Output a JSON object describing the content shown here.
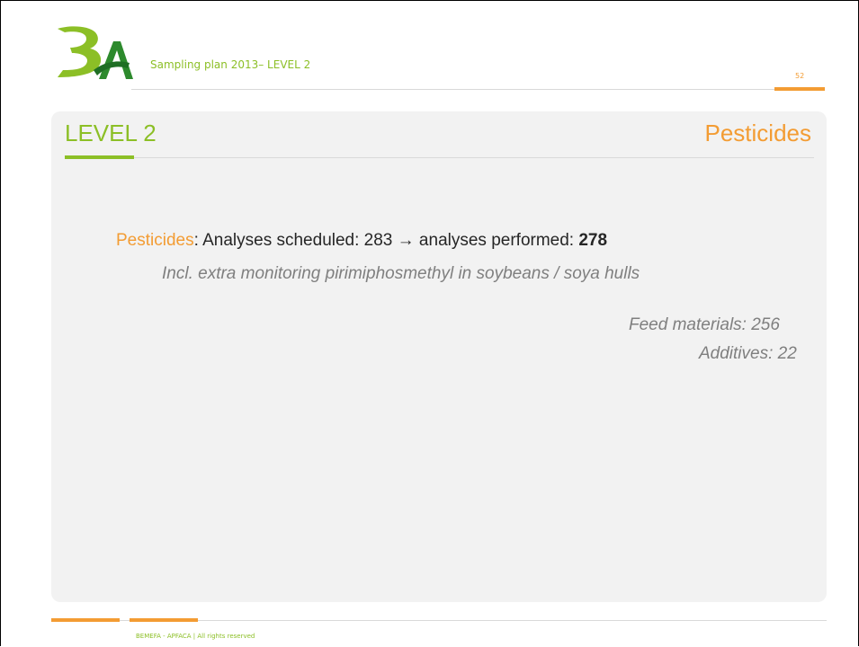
{
  "header": {
    "title": "Sampling plan 2013– LEVEL 2",
    "page_number": "52"
  },
  "slide": {
    "level_title": "LEVEL 2",
    "section_title": "Pesticides"
  },
  "content": {
    "main_prefix": "Pesticides",
    "main_middle": ": Analyses scheduled: 283 → analyses performed: ",
    "main_value": "278",
    "note": "Incl. extra monitoring pirimiphosmethyl in soybeans / soya hulls",
    "feed_materials": "Feed materials: 256",
    "additives": "Additives: 22"
  },
  "footer": {
    "text": "BEMEFA - APFACA  |  All rights reserved"
  },
  "colors": {
    "green": "#8cbf26",
    "orange": "#f39c33",
    "panel": "#f2f2f2"
  }
}
